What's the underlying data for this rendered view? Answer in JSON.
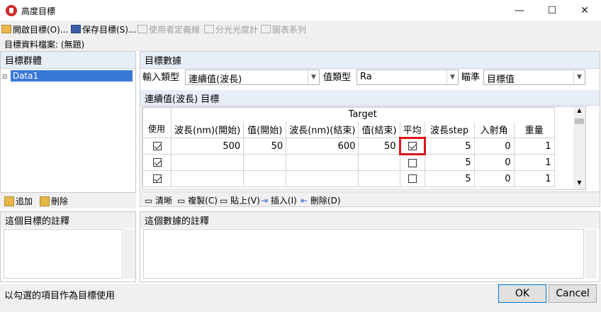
{
  "window": {
    "title": "高度目標"
  },
  "toolbar": {
    "open_label": "開啟目標(O)...",
    "save_label": "保存目標(S)...",
    "user_def_label": "使用者定義線",
    "spectro_label": "分光光度計",
    "chart_label": "圖表系列"
  },
  "file_info": "目標資料檔案: (無題)",
  "left": {
    "title": "目標群體",
    "items": [
      {
        "label": "Data1"
      }
    ],
    "add_label": "追加",
    "delete_label": "刪除",
    "note_title": "這個目標的註釋"
  },
  "right": {
    "title": "目標數據",
    "input_type_label": "輸入類型",
    "input_type_value": "連續值(波長)",
    "value_type_label": "值類型",
    "value_type_value": "Ra",
    "aim_label": "瞄準",
    "aim_value": "目標值",
    "section_title": "連續值(波長) 目標",
    "table": {
      "group_header": "Target",
      "columns": [
        "使用",
        "波長(nm)(開始)",
        "值(開始)",
        "波長(nm)(結束)",
        "值(結束)",
        "平均",
        "波長step",
        "入射角",
        "重量"
      ],
      "rows": [
        {
          "use": true,
          "wl_start": "500",
          "v_start": "50",
          "wl_end": "600",
          "v_end": "50",
          "avg": true,
          "step": "5",
          "angle": "0",
          "weight": "1"
        },
        {
          "use": true,
          "wl_start": "",
          "v_start": "",
          "wl_end": "",
          "v_end": "",
          "avg": false,
          "step": "5",
          "angle": "0",
          "weight": "1"
        },
        {
          "use": true,
          "wl_start": "",
          "v_start": "",
          "wl_end": "",
          "v_end": "",
          "avg": false,
          "step": "5",
          "angle": "0",
          "weight": "1"
        }
      ]
    },
    "actions": {
      "clear": "清晰",
      "copy": "複製(C)",
      "paste": "貼上(V)",
      "insert": "插入(I)",
      "delete": "刪除(D)"
    },
    "note_title": "這個數據的註釋"
  },
  "status_text": "以勾選的項目作為目標使用",
  "buttons": {
    "ok": "OK",
    "cancel": "Cancel"
  }
}
